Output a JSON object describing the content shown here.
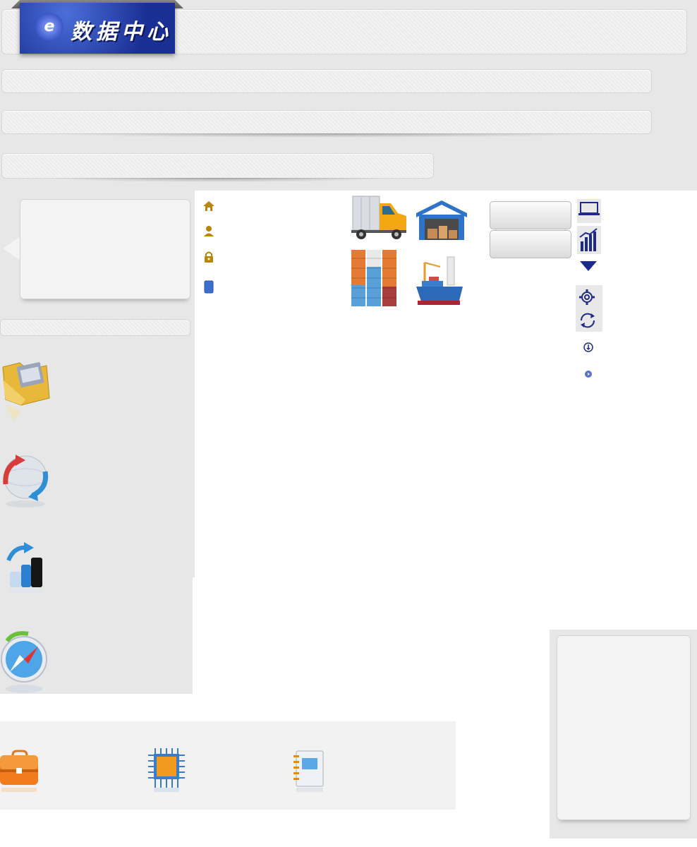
{
  "header": {
    "logo_text": "数据中心",
    "logo_mark": "e"
  },
  "nav_icons": [
    "home-icon",
    "user-icon",
    "lock-icon",
    "tablet-icon"
  ],
  "pictures": [
    "truck-icon",
    "warehouse-icon",
    "containers-icon",
    "cargo-ship-icon"
  ],
  "buttons": [
    {
      "label": ""
    },
    {
      "label": ""
    }
  ],
  "tool_icons": [
    "laptop-icon",
    "chart-icon",
    "triangle-down-icon",
    "gear-icon",
    "sync-icon",
    "download-circle-icon",
    "play-circle-icon"
  ],
  "left_icons": [
    "folder-icon",
    "globe-sync-icon",
    "growth-chart-icon",
    "compass-icon"
  ],
  "bottom_icons": [
    "briefcase-icon",
    "cpu-chip-icon",
    "notebook-icon"
  ],
  "colors": {
    "accent_gold": "#b8860b",
    "logo_blue": "#1a2f94",
    "tool_blue": "#1e2a8a",
    "panel_gray": "#e7e7e7"
  }
}
